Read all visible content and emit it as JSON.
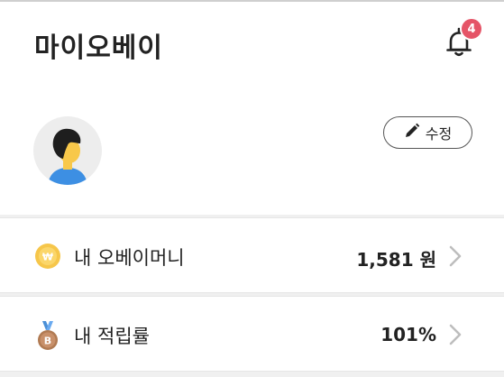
{
  "header": {
    "title": "마이오베이",
    "notification_count": "4",
    "bell_icon": "bell-icon"
  },
  "profile": {
    "edit_label": "수정",
    "edit_icon": "pencil-icon",
    "avatar_icon": "user-avatar"
  },
  "rows": [
    {
      "label": "내 오베이머니",
      "value": "1,581 원",
      "icon": "won-coin-icon"
    },
    {
      "label": "내 적립률",
      "value": "101%",
      "icon": "bronze-medal-icon"
    }
  ],
  "colors": {
    "badge": "#e55467",
    "coin": "#f6c64a",
    "medal": "#b07a52",
    "ribbon": "#4a8fd6"
  }
}
